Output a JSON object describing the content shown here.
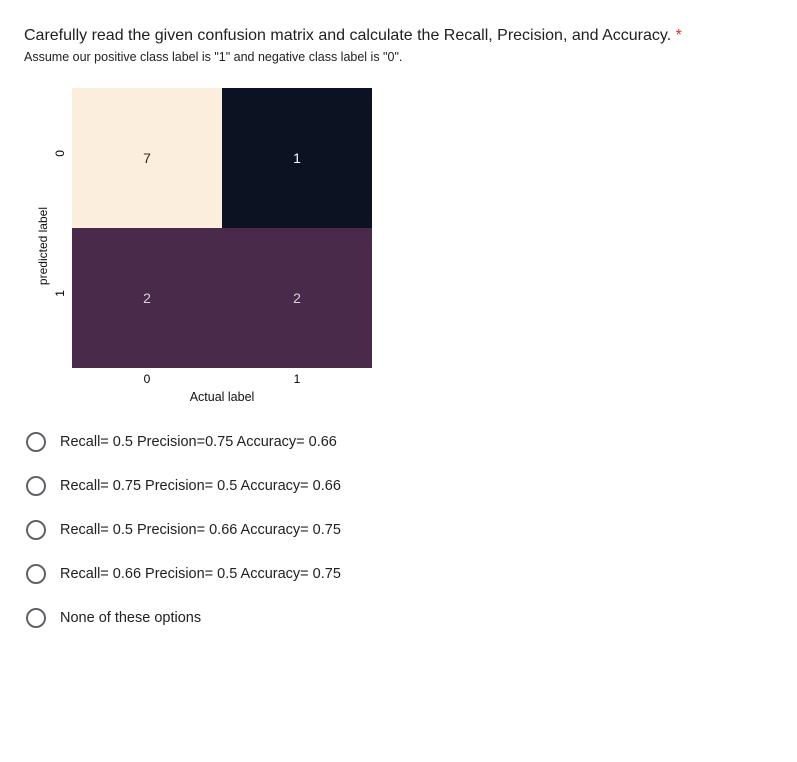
{
  "question": {
    "title": "Carefully read the given confusion matrix and calculate the Recall, Precision, and Accuracy.",
    "required_marker": "*",
    "sub_text": "Assume our positive class label is \"1\" and negative class label is \"0\"."
  },
  "chart_data": {
    "type": "heatmap",
    "xlabel": "Actual label",
    "ylabel": "predicted label",
    "x_ticks": [
      "0",
      "1"
    ],
    "y_ticks": [
      "0",
      "1"
    ],
    "cells": {
      "tl": "7",
      "tr": "1",
      "bl": "2",
      "br": "2"
    },
    "colors": {
      "tl": "#fbeedc",
      "tr": "#0c1222",
      "bl": "#4a2a4a",
      "br": "#4a2a4a"
    }
  },
  "options": [
    {
      "label": "Recall= 0.5 Precision=0.75 Accuracy= 0.66"
    },
    {
      "label": "Recall= 0.75 Precision= 0.5 Accuracy= 0.66"
    },
    {
      "label": "Recall= 0.5 Precision= 0.66 Accuracy= 0.75"
    },
    {
      "label": "Recall= 0.66 Precision= 0.5 Accuracy= 0.75"
    },
    {
      "label": "None of these options"
    }
  ]
}
